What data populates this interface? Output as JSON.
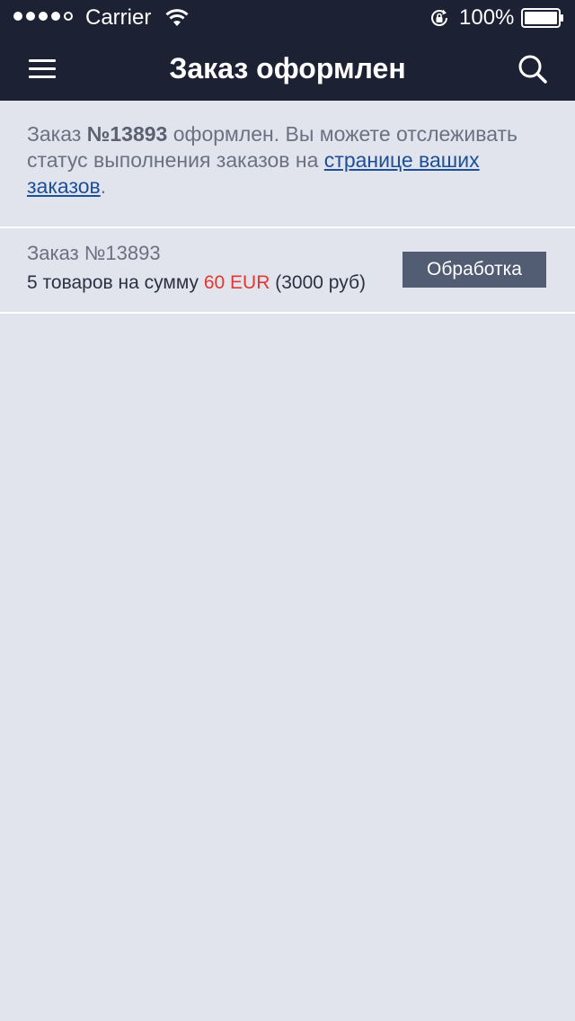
{
  "status_bar": {
    "carrier": "Carrier",
    "battery": "100%",
    "signal_bars_filled": 4,
    "signal_bars_total": 5
  },
  "nav": {
    "title": "Заказ оформлен",
    "menu_icon": "hamburger-menu-icon",
    "search_icon": "search-icon"
  },
  "info": {
    "prefix": "Заказ ",
    "order_number": "№13893",
    "middle": " оформлен. Вы можете отслеживать статус выполнения заказов на ",
    "link_text": "странице ваших заказов",
    "suffix": "."
  },
  "order": {
    "title": "Заказ №13893",
    "summary_prefix": "5 товаров на сумму ",
    "price": "60 EUR",
    "summary_suffix": " (3000 руб)",
    "status_label": "Обработка"
  },
  "colors": {
    "header_bg": "#1c2133",
    "page_bg": "#e1e4ed",
    "link": "#1d4f97",
    "price": "#e4372f",
    "status_button": "#525c72"
  }
}
